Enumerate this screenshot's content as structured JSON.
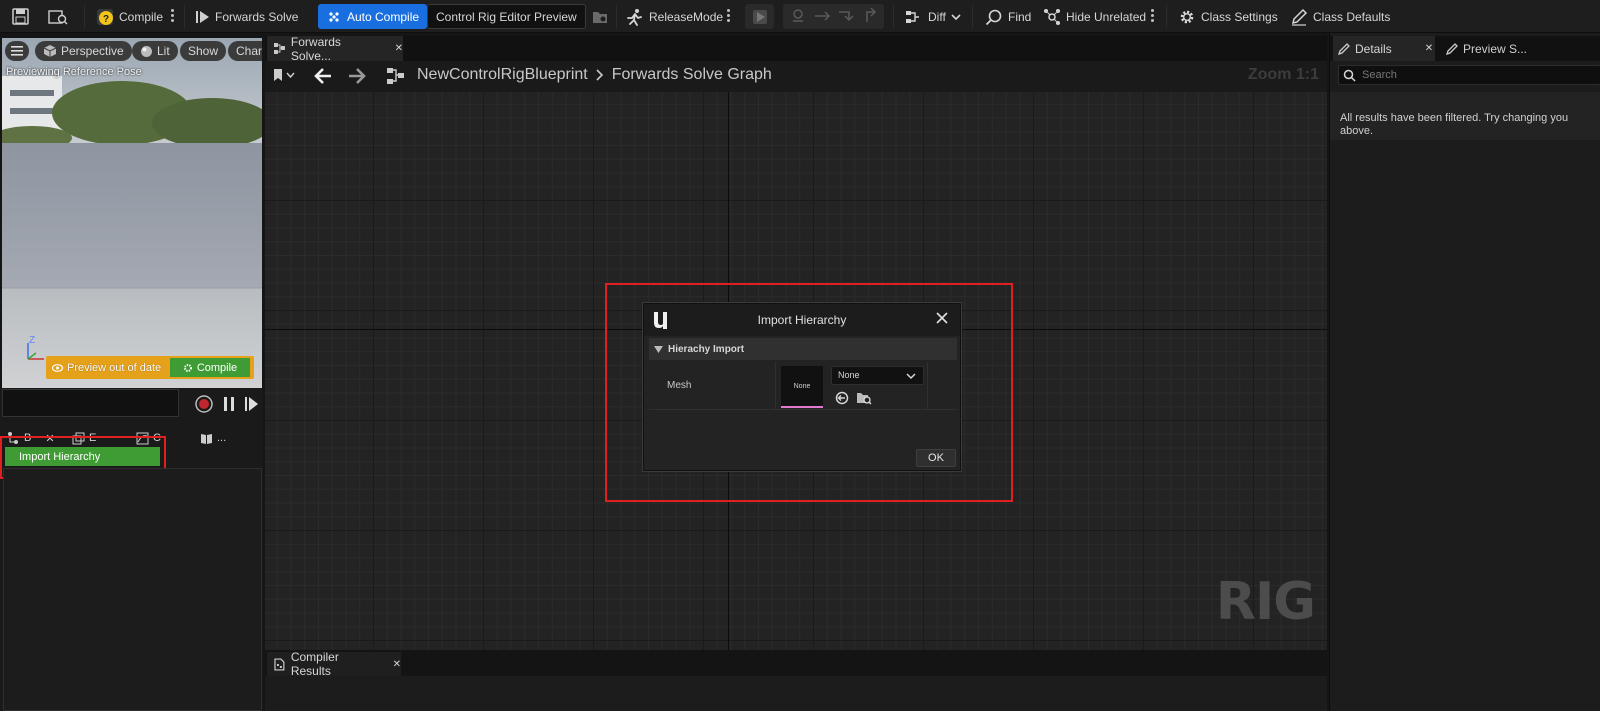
{
  "toolbar": {
    "compile": "Compile",
    "forwards_solve": "Forwards Solve",
    "auto_compile": "Auto Compile",
    "preview_dropdown": "Control Rig Editor Preview",
    "release_mode": "ReleaseMode",
    "diff": "Diff",
    "find": "Find",
    "hide_unrelated": "Hide Unrelated",
    "class_settings": "Class Settings",
    "class_defaults": "Class Defaults"
  },
  "viewport": {
    "perspective": "Perspective",
    "lit": "Lit",
    "show": "Show",
    "chara": "Chara",
    "status": "Previewing Reference Pose",
    "axis_label": "Z",
    "preview_out_of_date": "Preview out of date",
    "compile_button": "Compile"
  },
  "left_panel": {
    "tabs": [
      {
        "label": "B"
      },
      {
        "label": "E"
      },
      {
        "label": "C"
      },
      {
        "label": "..."
      }
    ],
    "import_hierarchy": "Import Hierarchy"
  },
  "graph_tab": {
    "tab_label": "Forwards Solve...",
    "breadcrumb_root": "NewControlRigBlueprint",
    "breadcrumb_graph": "Forwards Solve Graph",
    "zoom": "Zoom 1:1",
    "watermark": "RIG"
  },
  "dialog": {
    "title": "Import Hierarchy",
    "section": "Hierachy Import",
    "mesh_label": "Mesh",
    "thumbnail_text": "None",
    "dropdown_value": "None",
    "ok": "OK"
  },
  "bottom": {
    "compiler_results": "Compiler Results"
  },
  "details": {
    "tab_details": "Details",
    "tab_preview": "Preview S...",
    "search_placeholder": "Search",
    "filtered_message": "All results have been filtered. Try changing you above."
  },
  "colors": {
    "accent_blue": "#1a6fe0",
    "import_green": "#3f9c35",
    "warning_orange": "#e6a11a",
    "highlight_red": "#e02020"
  }
}
